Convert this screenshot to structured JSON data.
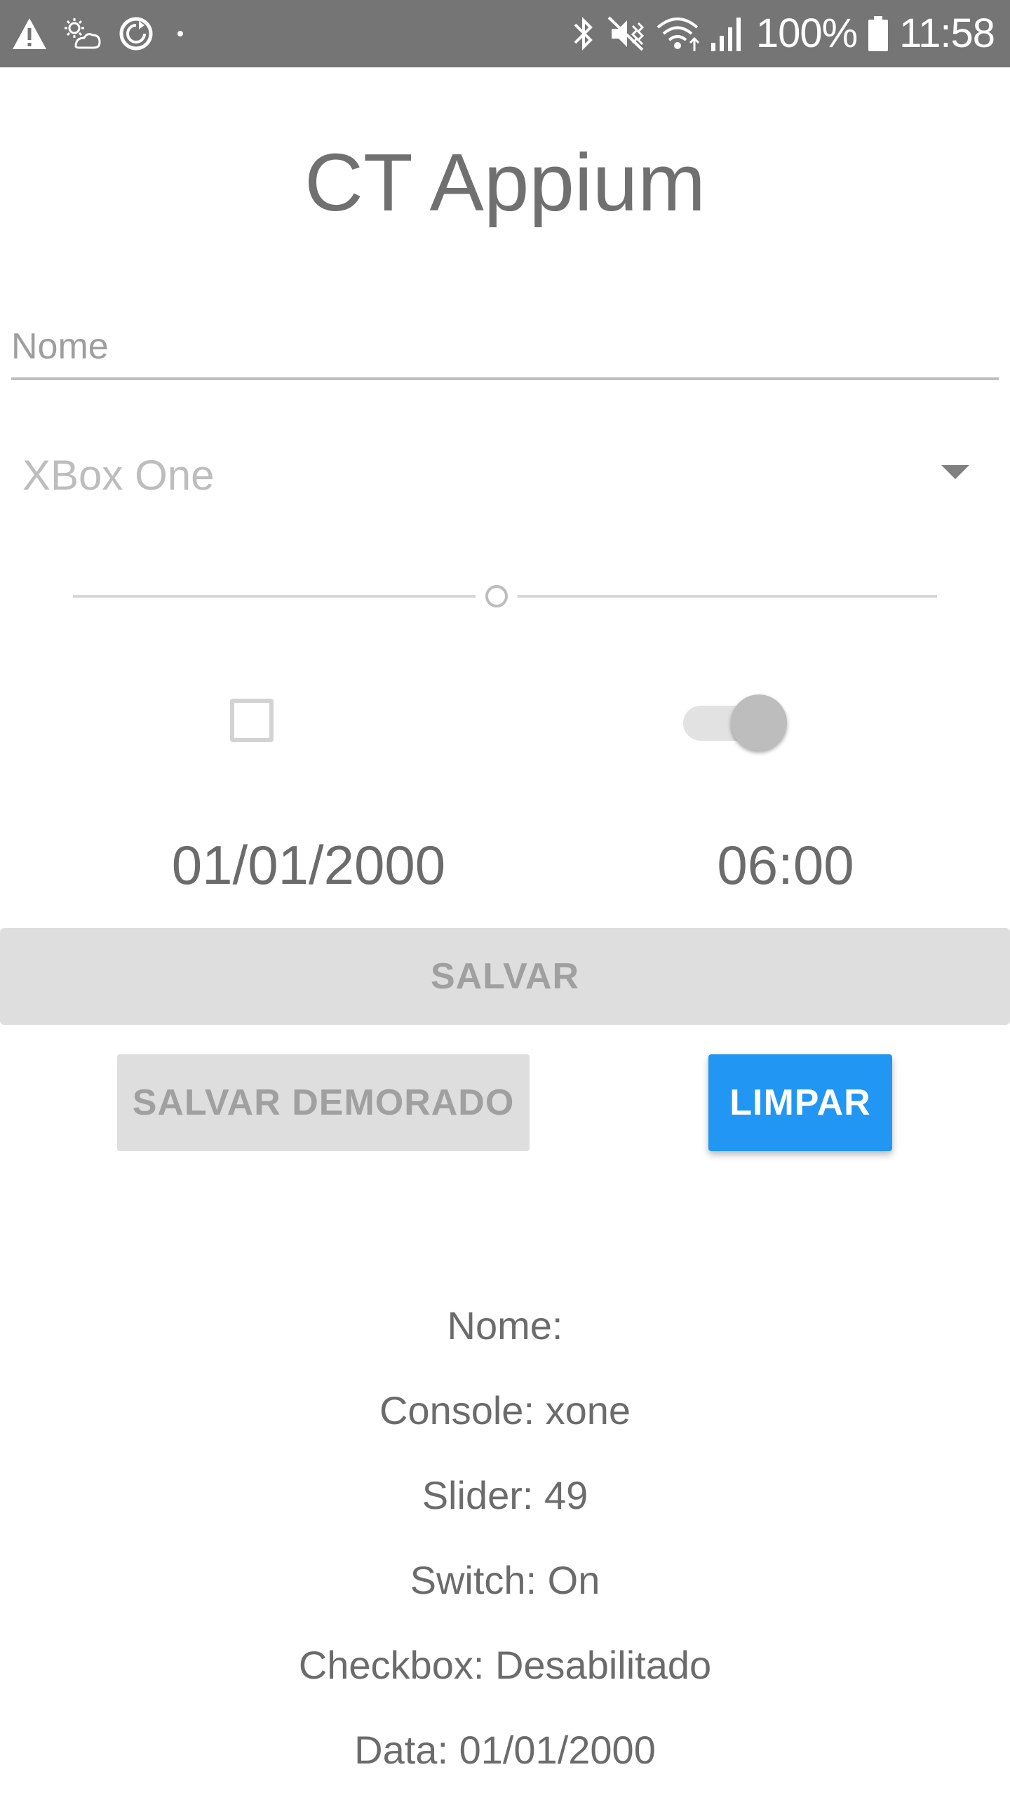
{
  "status_bar": {
    "icons_left": [
      "warning-icon",
      "weather-icon",
      "sync-icon",
      "dot-icon"
    ],
    "icons_right": [
      "bluetooth-icon",
      "vibrate-mute-icon",
      "wifi-icon",
      "signal-icon",
      "battery-icon"
    ],
    "battery": "100%",
    "time": "11:58"
  },
  "app": {
    "title": "CT Appium"
  },
  "form": {
    "name_placeholder": "Nome",
    "name_value": "",
    "console_selected": "XBox One",
    "slider_value": 49,
    "checkbox_checked": false,
    "switch_on": true,
    "date": "01/01/2000",
    "time": "06:00"
  },
  "buttons": {
    "save": "SALVAR",
    "save_delayed": "SALVAR DEMORADO",
    "clear": "LIMPAR"
  },
  "colors": {
    "status_bar": "#757575",
    "accent": "#2196f3",
    "disabled_button": "#dedede"
  },
  "results": [
    "Nome:",
    "Console: xone",
    "Slider: 49",
    "Switch: On",
    "Checkbox: Desabilitado",
    "Data: 01/01/2000"
  ]
}
